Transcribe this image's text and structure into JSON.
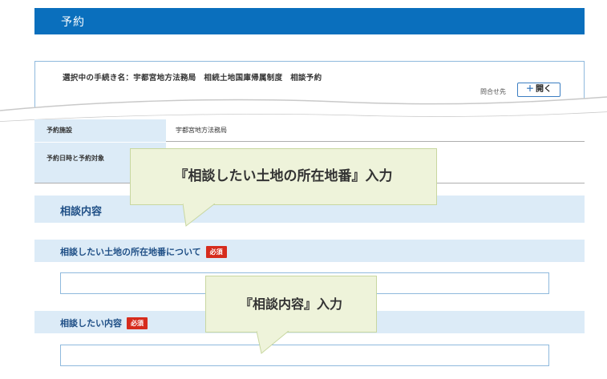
{
  "header": {
    "title": "予約"
  },
  "procedure": {
    "label": "選択中の手続き名：",
    "name": "宇都宮地方法務局　相続土地国庫帰属制度　相談予約",
    "inquiry_label": "問合せ先",
    "open_button_plus": "＋",
    "open_button_label": "開く"
  },
  "reservation": {
    "facility_label": "予約施設",
    "facility_value": "宇都宮地方法務局",
    "datetime_label": "予約日時と予約対象"
  },
  "section": {
    "title": "相談内容"
  },
  "fields": [
    {
      "label": "相談したい土地の所在地番について",
      "required_badge": "必須",
      "value": ""
    },
    {
      "label": "相談したい内容",
      "required_badge": "必須",
      "value": ""
    }
  ],
  "callouts": [
    {
      "text": "『相談したい土地の所在地番』入力"
    },
    {
      "text": "『相談内容』入力"
    }
  ],
  "colors": {
    "header_bg": "#0a6fbd",
    "label_bg": "#dcebf7",
    "title_text": "#1f4f86",
    "required_badge": "#d62c1d",
    "callout_bg": "#eef3da"
  }
}
